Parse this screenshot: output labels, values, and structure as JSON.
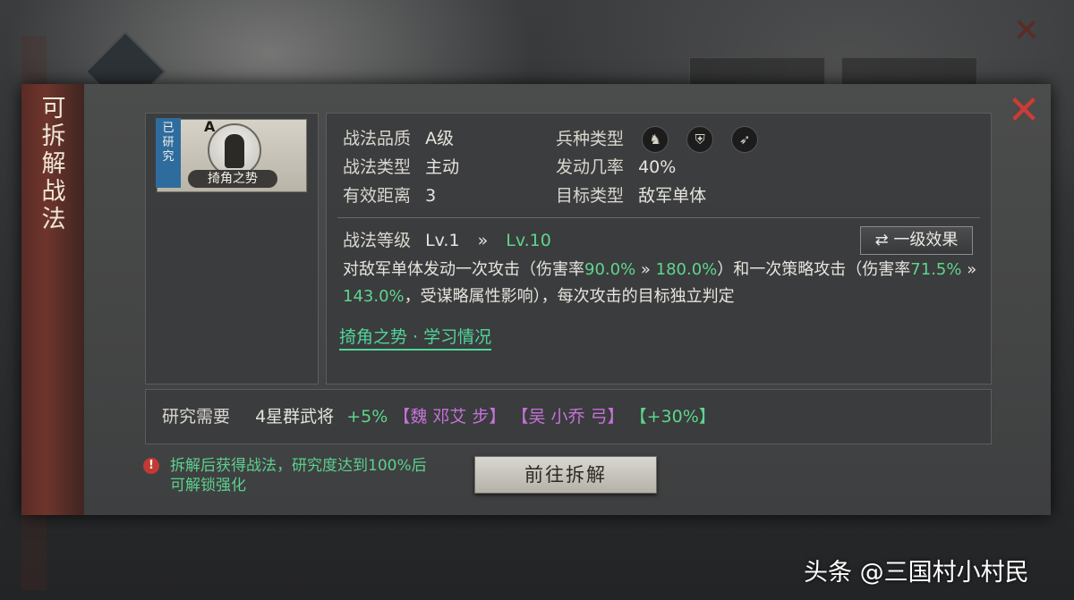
{
  "dialog": {
    "side_title": [
      "可",
      "拆",
      "解",
      "战",
      "法"
    ],
    "close_icon": "close-icon"
  },
  "skill_card": {
    "ribbon": [
      "已",
      "研",
      "究"
    ],
    "grade": "A",
    "name": "掎角之势"
  },
  "attributes": {
    "quality_label": "战法品质",
    "quality_value": "A级",
    "type_label": "战法类型",
    "type_value": "主动",
    "range_label": "有效距离",
    "range_value": "3",
    "troop_label": "兵种类型",
    "troop_icons": [
      "cavalry-icon",
      "shield-icon",
      "bow-icon"
    ],
    "rate_label": "发动几率",
    "rate_value": "40%",
    "target_label": "目标类型",
    "target_value": "敌军单体"
  },
  "level": {
    "label": "战法等级",
    "from": "Lv.1",
    "arrow": "»",
    "to": "Lv.10",
    "toggle_button": "⇄ 一级效果"
  },
  "description": {
    "p1": "对敌军单体发动一次攻击（伤害率",
    "v1": "90.0%",
    "a1": " » ",
    "v2": "180.0%",
    "p2": "）和一次策略攻击（伤害率",
    "v3": "71.5%",
    "a2": " » ",
    "v4": "143.0%",
    "p3": "，受谋略属性影响），每次攻击的目标独立判定"
  },
  "learn_link": "掎角之势 · 学习情况",
  "research": {
    "label": "研究需要",
    "req": "4星群武将",
    "bonus1": "+5%",
    "wei": "【魏 邓艾 步】",
    "wu": "【吴 小乔 弓】",
    "bonus2": "【+30%】"
  },
  "warning": {
    "line1": "拆解后获得战法，研究度达到100%后",
    "line2": "可解锁强化"
  },
  "go_button": "前往拆解",
  "watermark": "头条 @三国村小村民",
  "colors": {
    "accent_green": "#5fd58e",
    "purple": "#c672d8",
    "close_red": "#cf3b33",
    "ribbon_blue": "#2f6c9e"
  }
}
